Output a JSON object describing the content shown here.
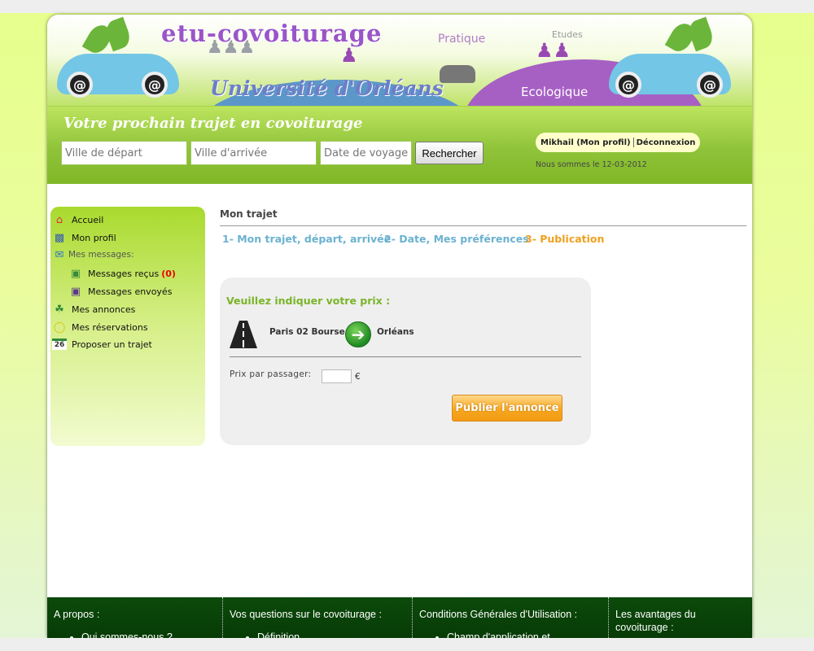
{
  "banner": {
    "logo_text": "etu-covoiturage",
    "university_text": "Université d'Orléans",
    "tag_pratique": "Pratique",
    "tag_etudes": "Etudes",
    "tag_ecologique": "Ecologique",
    "wheel_symbol": "@"
  },
  "search": {
    "title": "Votre prochain trajet en covoiturage",
    "departure_placeholder": "Ville de départ",
    "arrival_placeholder": "Ville d'arrivée",
    "date_placeholder": "Date de voyage",
    "search_button": "Rechercher"
  },
  "user": {
    "profile_link": "Mikhail (Mon profil)",
    "logout_link": "Déconnexion",
    "date_text": "Nous sommes le 12-03-2012"
  },
  "sidebar": {
    "items": [
      {
        "label": "Accueil",
        "icon": "home-icon"
      },
      {
        "label": "Mon profil",
        "icon": "profile-icon"
      },
      {
        "label": "Mes messages:",
        "icon": "envelope-icon"
      },
      {
        "label": "Messages reçus",
        "count": "(0)",
        "icon": "inbox-icon"
      },
      {
        "label": "Messages envoyés",
        "icon": "sent-icon"
      },
      {
        "label": "Mes annonces",
        "icon": "annonces-icon"
      },
      {
        "label": "Mes réservations",
        "icon": "lightbulb-icon"
      },
      {
        "label": "Proposer un trajet",
        "icon": "calendar-icon",
        "calendar_day": "26"
      }
    ]
  },
  "main": {
    "title": "Mon trajet",
    "steps": [
      "1- Mon trajet, départ, arrivée",
      "2- Date, Mes préférences",
      "3- Publication"
    ],
    "active_step": 3,
    "card": {
      "heading": "Veuillez indiquer votre prix :",
      "from_city": "Paris 02 Bourse",
      "to_city": "Orléans",
      "price_label": "Prix par passager:",
      "price_value": "",
      "currency": "€",
      "publish_button": "Publier l'annonce"
    }
  },
  "footer": {
    "columns": [
      {
        "title": "A propos :",
        "first_item": "Qui sommes-nous ?"
      },
      {
        "title": "Vos questions sur le covoiturage :",
        "first_item": "Définition"
      },
      {
        "title": "Conditions Générales d'Utilisation :",
        "first_item": "Champ d'application et"
      },
      {
        "title": "Les avantages du covoiturage :",
        "first_item": ""
      }
    ]
  },
  "colors": {
    "accent_green": "#7ab528",
    "step_blue": "#6bb2d0",
    "step_active": "#f0a020",
    "footer_bg": "#0c4a0a",
    "publish_orange": "#f6a821"
  }
}
